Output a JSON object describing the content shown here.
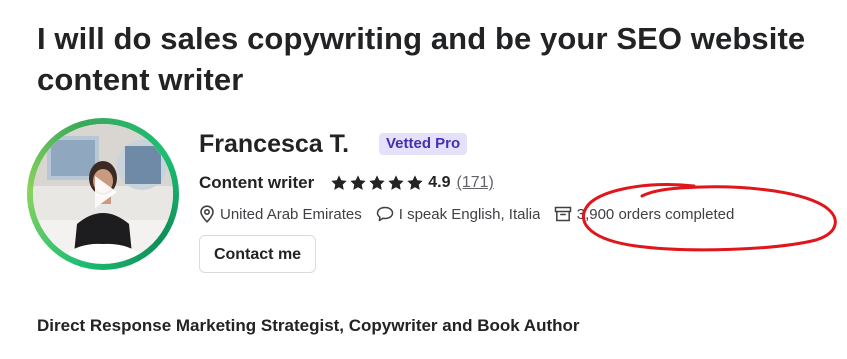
{
  "gig": {
    "title": "I will do sales copywriting and be your SEO website content writer"
  },
  "seller": {
    "name": "Francesca T.",
    "badge": "Vetted Pro",
    "profession": "Content writer",
    "rating": "4.9",
    "star_count": 5,
    "reviews": "(171)",
    "country": "United Arab Emirates",
    "languages": "I speak English, Italian",
    "orders": "3,900 orders completed",
    "contact_label": "Contact me",
    "tagline": "Direct Response Marketing Strategist, Copywriter and Book Author"
  },
  "icons": {
    "star": "star-icon",
    "location": "location-pin-icon",
    "language": "speech-bubble-icon",
    "orders": "box-icon",
    "avatar_play": "play-icon"
  },
  "colors": {
    "text_primary": "#222325",
    "badge_bg": "#e4e1fa",
    "badge_text": "#4530b3",
    "avatar_ring": "#1dbf73",
    "annotation": "#e0161b"
  }
}
